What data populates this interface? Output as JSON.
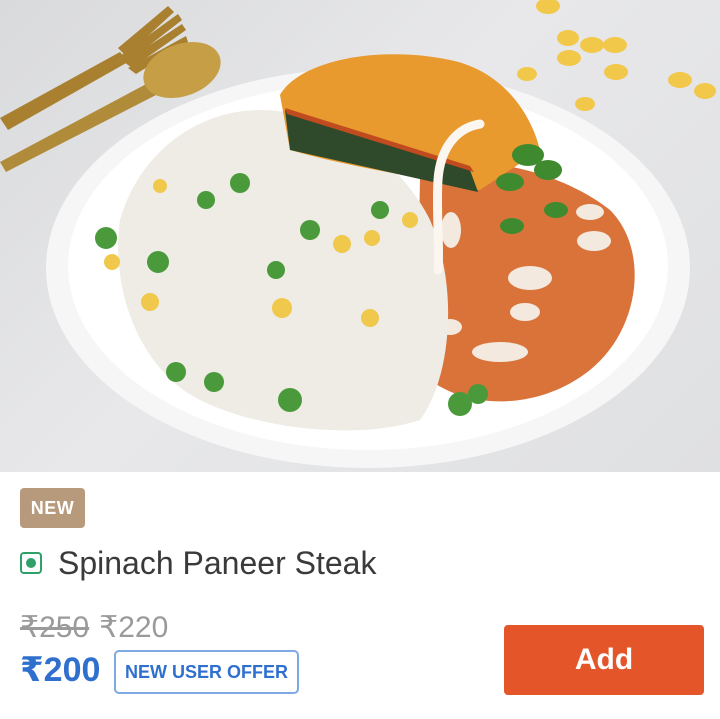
{
  "product": {
    "image_alt": "Spinach Paneer Steak served with pea pulao and makhani gravy",
    "badge": "NEW",
    "veg_indicator_icon": "veg-indicator-icon",
    "name": "Spinach Paneer Steak",
    "prices": {
      "mrp": "₹250",
      "discounted": "₹220",
      "final": "₹200"
    },
    "offer_label": "NEW USER OFFER",
    "add_label": "Add"
  },
  "colors": {
    "accent_button": "#e4552a",
    "price_blue": "#2f6fce",
    "veg_green": "#2fa06a",
    "badge_bg": "#b79a7c"
  }
}
